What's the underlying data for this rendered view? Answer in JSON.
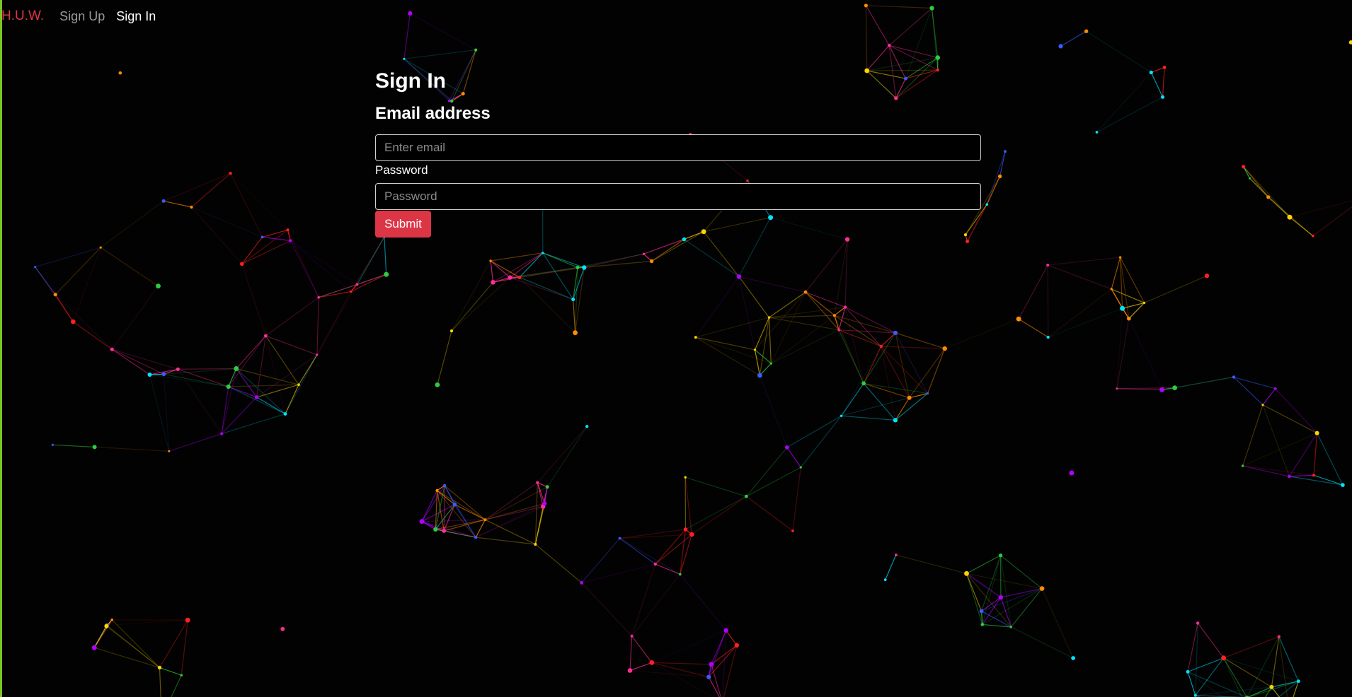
{
  "nav": {
    "brand": "H.U.W.",
    "brand_color": "#dc3545",
    "links": [
      {
        "label": "Sign Up",
        "active": false
      },
      {
        "label": "Sign In",
        "active": true
      }
    ]
  },
  "form": {
    "title": "Sign In",
    "email_label": "Email address",
    "email_placeholder": "Enter email",
    "email_value": "",
    "password_label": "Password",
    "password_placeholder": "Password",
    "password_value": "",
    "submit_label": "Submit",
    "submit_color": "#dc3545"
  },
  "background": {
    "type": "animated-particle-network",
    "colors": [
      "#2ecc40",
      "#00e5ff",
      "#3b5bff",
      "#b000ff",
      "#ff2d95",
      "#ff8c00",
      "#ffd400",
      "#ff2020"
    ]
  }
}
